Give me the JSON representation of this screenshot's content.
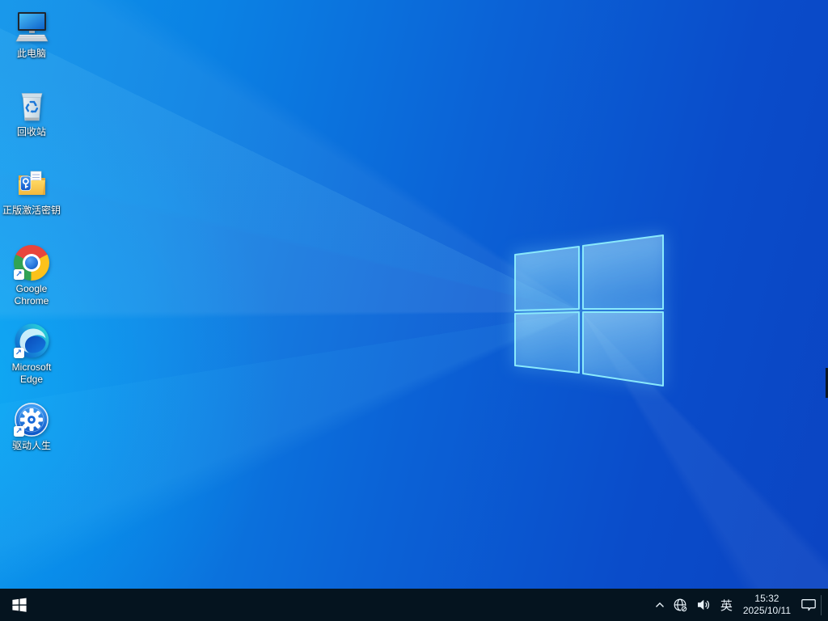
{
  "desktop": {
    "icons": [
      {
        "label": "此电脑"
      },
      {
        "label": "回收站"
      },
      {
        "label": "正版激活密钥"
      },
      {
        "label": "Google Chrome"
      },
      {
        "label": "Microsoft Edge"
      },
      {
        "label": "驱动人生"
      }
    ]
  },
  "taskbar": {
    "ime_indicator": "英",
    "clock": {
      "time": "15:32",
      "date": "2025/10/11"
    }
  },
  "colors": {
    "wallpaper_left": "#0d93ea",
    "wallpaper_bottom_left": "#00a5f3",
    "wallpaper_right": "#0a45c5",
    "logo_edge": "#8ae9fc",
    "taskbar_bg": "#05141f"
  }
}
